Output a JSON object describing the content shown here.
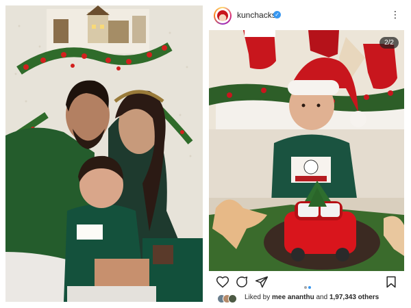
{
  "post": {
    "username": "kunchacks",
    "verified_icon": "verified-badge-icon",
    "more_icon": "more-options-icon",
    "page_counter": "2/2",
    "carousel": {
      "count": 2,
      "active": 2
    },
    "actions": [
      "heart-icon",
      "comment-icon",
      "share-icon",
      "bookmark-icon"
    ],
    "likes": {
      "prefix": "Liked by",
      "user1": "mee",
      "user2": "ananthu",
      "connector": "and",
      "count": "1,97,343 others"
    }
  },
  "colors": {
    "accent_blue": "#3897f0",
    "text": "#262626",
    "sweater_green": "#1f5a3c",
    "santa_red": "#c8161d"
  }
}
